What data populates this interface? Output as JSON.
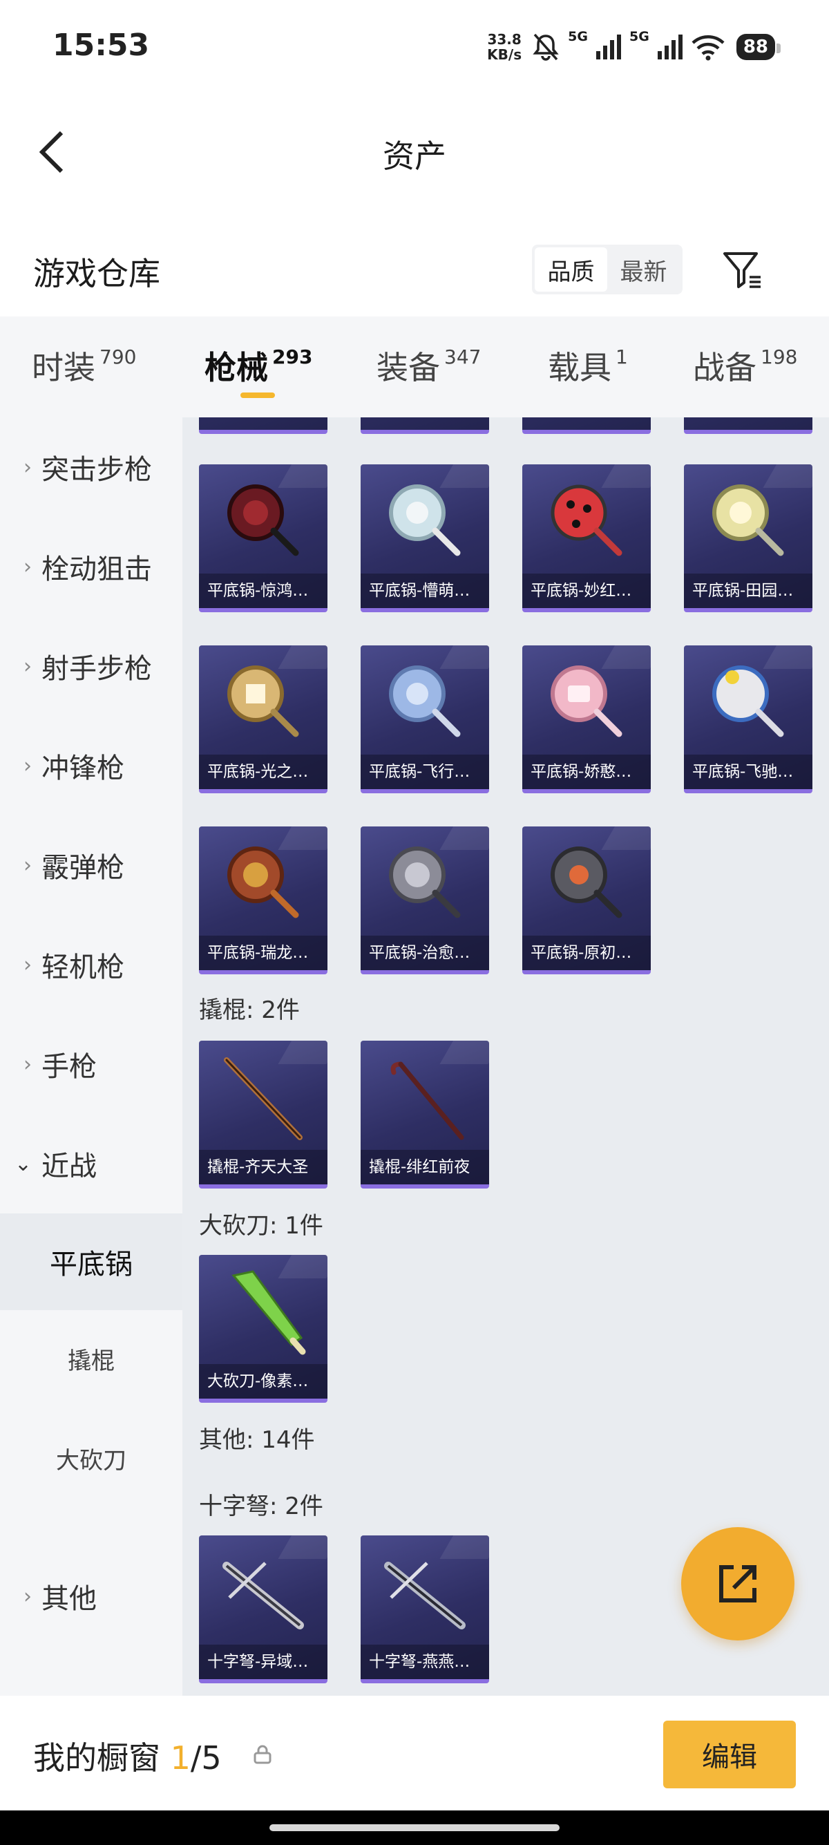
{
  "status_bar": {
    "time": "15:53",
    "speed": "33.8",
    "speed_unit": "KB/s",
    "net1": "5G",
    "net2": "5G",
    "battery": "88"
  },
  "nav": {
    "title": "资产"
  },
  "warehouse": {
    "title": "游戏仓库",
    "sort_options": [
      "品质",
      "最新"
    ],
    "sort_selected": "品质"
  },
  "tabs": [
    {
      "label": "时装",
      "count": "790"
    },
    {
      "label": "枪械",
      "count": "293"
    },
    {
      "label": "装备",
      "count": "347"
    },
    {
      "label": "载具",
      "count": "1"
    },
    {
      "label": "战备",
      "count": "198"
    }
  ],
  "active_tab": "枪械",
  "sidebar": {
    "categories": [
      "突击步枪",
      "栓动狙击",
      "射手步枪",
      "冲锋枪",
      "霰弹枪",
      "轻机枪",
      "手枪",
      "近战"
    ],
    "sub_items": [
      "平底锅",
      "撬棍",
      "大砍刀"
    ],
    "other": "其他"
  },
  "sections": {
    "pans": [
      "平底锅-惊鸿…",
      "平底锅-懵萌…",
      "平底锅-妙红…",
      "平底锅-田园…",
      "平底锅-光之…",
      "平底锅-飞行…",
      "平底锅-娇憨…",
      "平底锅-飞驰…",
      "平底锅-瑞龙…",
      "平底锅-治愈…",
      "平底锅-原初…"
    ],
    "crowbar_header": "撬棍: 2件",
    "crowbars": [
      "撬棍-齐天大圣",
      "撬棍-绯红前夜"
    ],
    "machete_header": "大砍刀: 1件",
    "machetes": [
      "大砍刀-像素…"
    ],
    "other_header": "其他: 14件",
    "crossbow_header": "十字弩: 2件",
    "crossbows": [
      "十字弩-异域…",
      "十字弩-燕燕…"
    ]
  },
  "bottom": {
    "title": "我的橱窗",
    "current": "1",
    "total": "/5",
    "edit_label": "编辑"
  },
  "colors": {
    "accent": "#f5b83a",
    "card_bg": "#2e2e63",
    "card_border": "#8a6ee0"
  }
}
